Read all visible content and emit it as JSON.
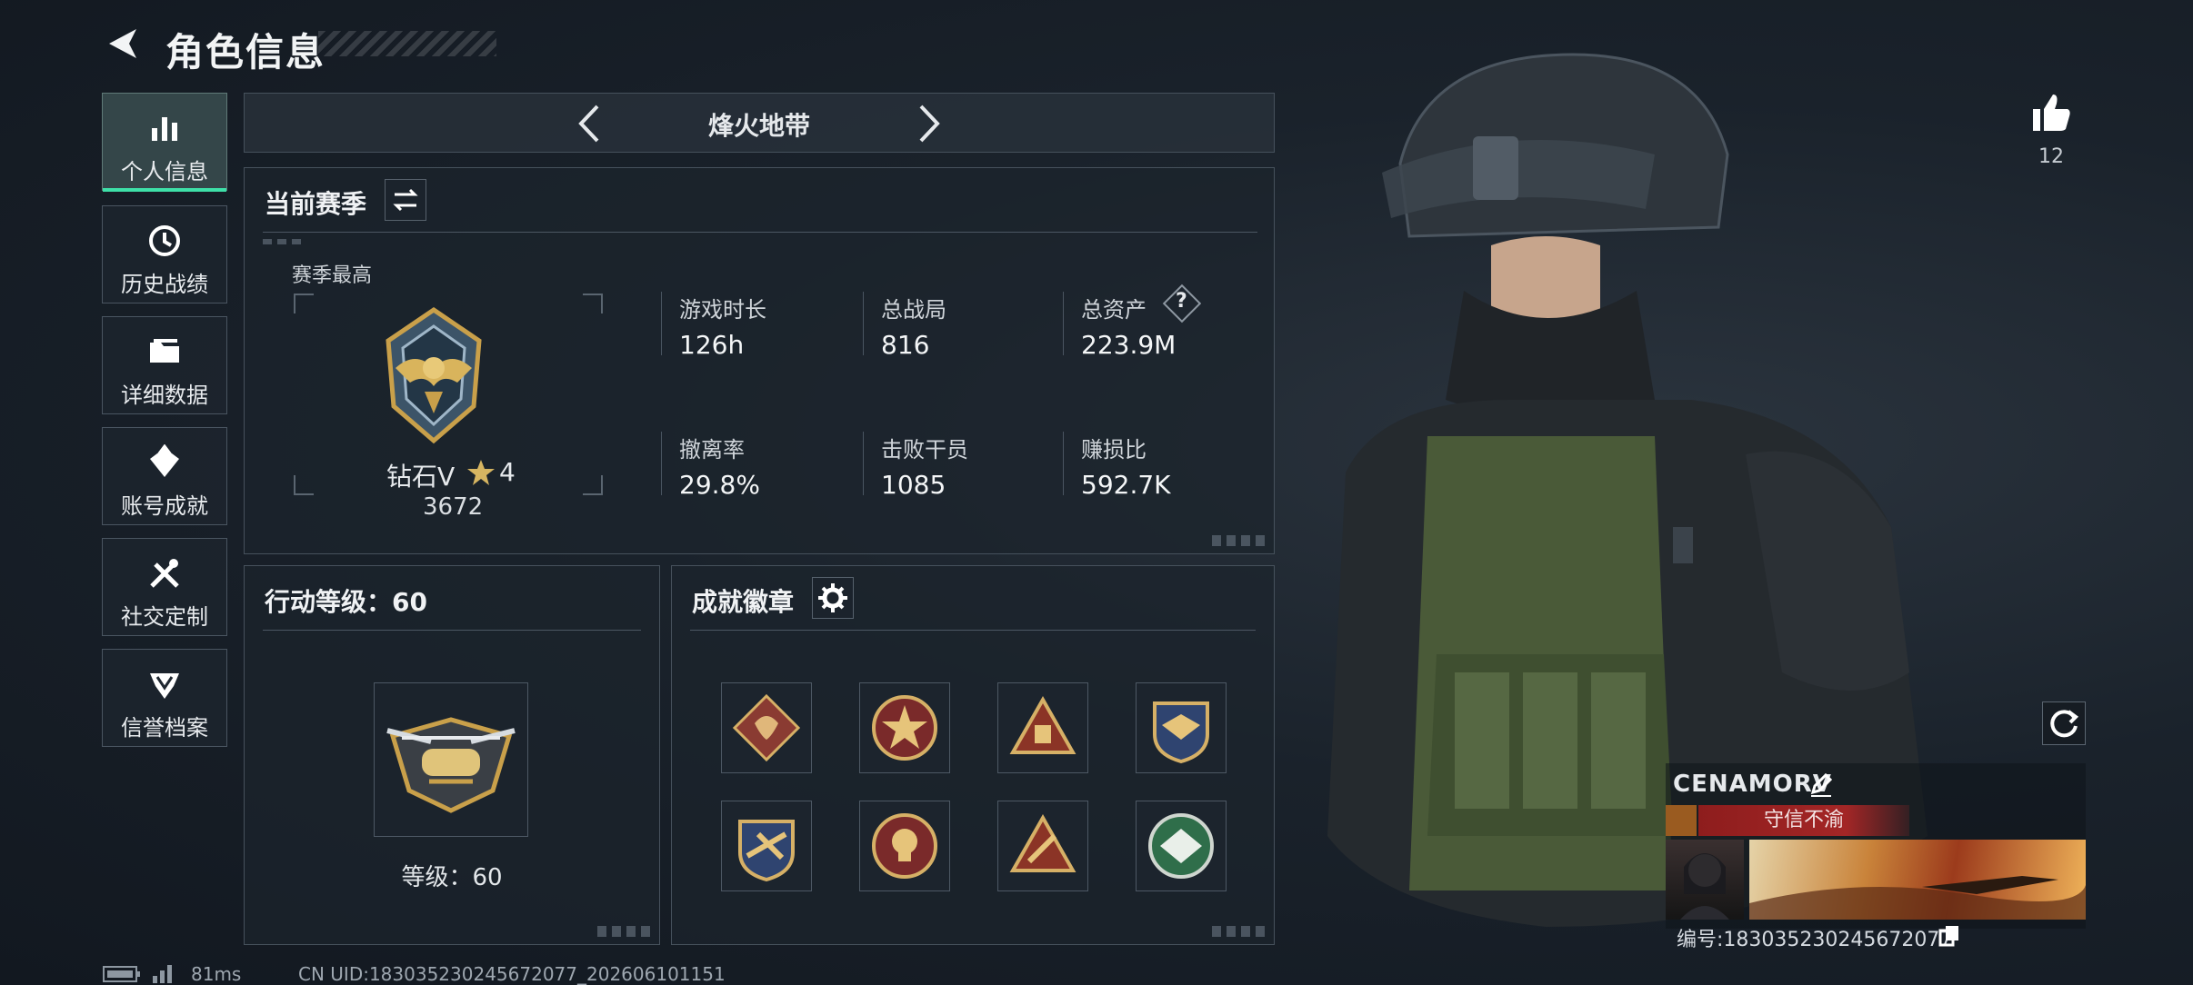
{
  "header": {
    "title": "角色信息"
  },
  "nav": [
    {
      "label": "个人信息",
      "icon": "bar-chart-icon",
      "active": true
    },
    {
      "label": "历史战绩",
      "icon": "history-icon"
    },
    {
      "label": "详细数据",
      "icon": "folder-icon"
    },
    {
      "label": "账号成就",
      "icon": "achievement-icon"
    },
    {
      "label": "社交定制",
      "icon": "tools-icon"
    },
    {
      "label": "信誉档案",
      "icon": "shield-icon"
    }
  ],
  "mode_selector": {
    "label": "烽火地带"
  },
  "season": {
    "title": "当前赛季",
    "best_label": "赛季最高",
    "rank_name": "钻石V",
    "rank_stars": "4",
    "rank_points": "3672",
    "stats": [
      {
        "label": "游戏时长",
        "value": "126h"
      },
      {
        "label": "总战局",
        "value": "816"
      },
      {
        "label": "总资产",
        "value": "223.9M",
        "help": "?"
      },
      {
        "label": "撤离率",
        "value": "29.8%"
      },
      {
        "label": "击败干员",
        "value": "1085"
      },
      {
        "label": "赚损比",
        "value": "592.7K"
      }
    ]
  },
  "action_level": {
    "title": "行动等级：60",
    "level_text": "等级：60"
  },
  "achievements": {
    "title": "成就徽章",
    "badges": [
      "dragon-badge",
      "star-badge",
      "triangle-badge",
      "blue-eagle-badge",
      "blue-eagle-badge-2",
      "skull-badge",
      "triangle-badge-2",
      "green-emblem-badge"
    ]
  },
  "like": {
    "count": "12"
  },
  "profile": {
    "name": "CENAMORV",
    "credit_tag": "守信不渝",
    "id_text": "编号:183035230245672077"
  },
  "status_bar": {
    "ping": "81ms",
    "uid": "CN UID:183035230245672077_202606101151"
  },
  "colors": {
    "accent": "#3ee0a8",
    "badge_red": "#8e1d1d",
    "gold": "#c9a04a"
  }
}
